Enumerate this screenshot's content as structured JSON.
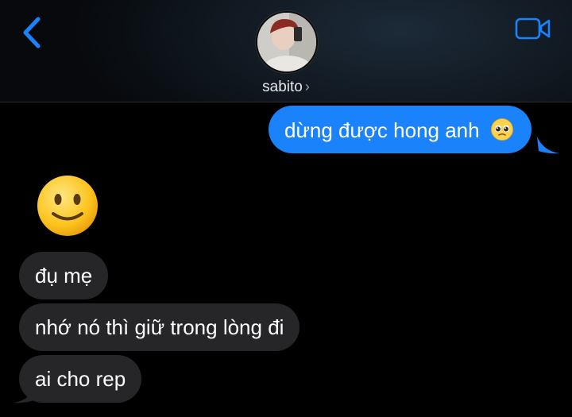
{
  "contact": {
    "name": "sabito",
    "name_chevron": "›"
  },
  "icons": {
    "back": "chevron-left-icon",
    "video": "video-camera-icon",
    "pleading": "pleading-face-emoji",
    "slightly_smiling": "slightly-smiling-face-emoji"
  },
  "colors": {
    "accent": "#1a82fb",
    "incoming_bubble": "#262629",
    "background": "#000000"
  },
  "messages": [
    {
      "direction": "outgoing",
      "text": "dừng được hong anh",
      "emoji": "🥺"
    },
    {
      "direction": "incoming",
      "emoji": "🙂"
    },
    {
      "direction": "incoming",
      "text": "đụ mẹ"
    },
    {
      "direction": "incoming",
      "text": "nhớ nó thì giữ trong lòng đi"
    },
    {
      "direction": "incoming",
      "text": "ai cho rep"
    }
  ]
}
